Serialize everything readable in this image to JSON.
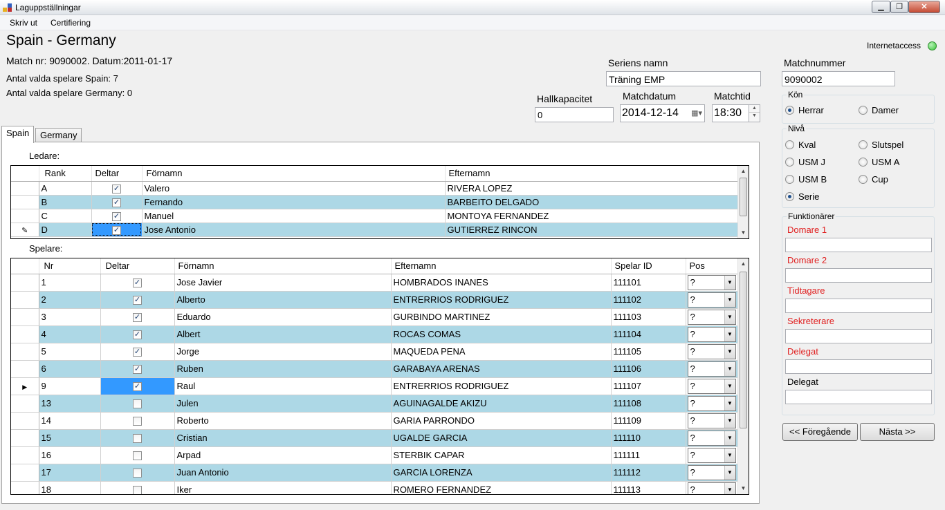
{
  "window": {
    "title": "Laguppställningar"
  },
  "menu": [
    {
      "label": "Skriv ut"
    },
    {
      "label": "Certifiering"
    }
  ],
  "header": {
    "title": "Spain - Germany",
    "match_info": "Match nr: 9090002.  Datum:2011-01-17",
    "selected_home": "Antal valda spelare Spain: 7",
    "selected_away": "Antal valda spelare Germany: 0",
    "internet_label": "Internetaccess",
    "internet_status_color": "#3cc83c"
  },
  "fields": {
    "series_label": "Seriens namn",
    "series_value": "Träning EMP",
    "matchnr_label": "Matchnummer",
    "matchnr_value": "9090002",
    "hall_label": "Hallkapacitet",
    "hall_value": "0",
    "date_label": "Matchdatum",
    "date_value": "2014-12-14",
    "time_label": "Matchtid",
    "time_value": "18:30",
    "calendar_icon": "calendar-icon"
  },
  "gender": {
    "title": "Kön",
    "options": [
      {
        "label": "Herrar",
        "selected": true
      },
      {
        "label": "Damer",
        "selected": false
      }
    ]
  },
  "level": {
    "title": "Nivå",
    "options": [
      {
        "label": "Kval",
        "selected": false
      },
      {
        "label": "Slutspel",
        "selected": false
      },
      {
        "label": "USM J",
        "selected": false
      },
      {
        "label": "USM A",
        "selected": false
      },
      {
        "label": "USM B",
        "selected": false
      },
      {
        "label": "Cup",
        "selected": false
      },
      {
        "label": "Serie",
        "selected": true
      }
    ]
  },
  "officials": {
    "title": "Funktionärer",
    "items": [
      {
        "label": "Domare 1",
        "value": ""
      },
      {
        "label": "Domare 2",
        "value": ""
      },
      {
        "label": "Tidtagare",
        "value": ""
      },
      {
        "label": "Sekreterare",
        "value": ""
      },
      {
        "label": "Delegat",
        "value": ""
      },
      {
        "label": "Delegat",
        "value": ""
      }
    ],
    "required_color": "#e02020"
  },
  "nav": {
    "prev_label": "<< Föregående",
    "next_label": "Nästa >>"
  },
  "tabs": [
    {
      "label": "Spain",
      "active": true
    },
    {
      "label": "Germany",
      "active": false
    }
  ],
  "leaders": {
    "label": "Ledare:",
    "columns": [
      "Rank",
      "Deltar",
      "Förnamn",
      "Efternamn"
    ],
    "rows": [
      {
        "rank": "A",
        "deltar": true,
        "first": "Valero",
        "last": "RIVERA LOPEZ"
      },
      {
        "rank": "B",
        "deltar": true,
        "first": "Fernando",
        "last": "BARBEITO DELGADO"
      },
      {
        "rank": "C",
        "deltar": true,
        "first": "Manuel",
        "last": "MONTOYA FERNANDEZ"
      },
      {
        "rank": "D",
        "deltar": true,
        "first": "Jose Antonio",
        "last": "GUTIERREZ RINCON"
      }
    ]
  },
  "players": {
    "label": "Spelare:",
    "columns": [
      "Nr",
      "Deltar",
      "Förnamn",
      "Efternamn",
      "Spelar ID",
      "Pos"
    ],
    "rows": [
      {
        "nr": "1",
        "deltar": true,
        "first": "Jose Javier",
        "last": "HOMBRADOS INANES",
        "id": "111101",
        "pos": "?"
      },
      {
        "nr": "2",
        "deltar": true,
        "first": "Alberto",
        "last": "ENTRERRIOS RODRIGUEZ",
        "id": "111102",
        "pos": "?"
      },
      {
        "nr": "3",
        "deltar": true,
        "first": "Eduardo",
        "last": "GURBINDO MARTINEZ",
        "id": "111103",
        "pos": "?"
      },
      {
        "nr": "4",
        "deltar": true,
        "first": "Albert",
        "last": "ROCAS COMAS",
        "id": "111104",
        "pos": "?"
      },
      {
        "nr": "5",
        "deltar": true,
        "first": "Jorge",
        "last": "MAQUEDA PENA",
        "id": "111105",
        "pos": "?"
      },
      {
        "nr": "6",
        "deltar": true,
        "first": "Ruben",
        "last": "GARABAYA ARENAS",
        "id": "111106",
        "pos": "?"
      },
      {
        "nr": "9",
        "deltar": true,
        "first": "Raul",
        "last": "ENTRERRIOS RODRIGUEZ",
        "id": "111107",
        "pos": "?"
      },
      {
        "nr": "13",
        "deltar": false,
        "first": "Julen",
        "last": "AGUINAGALDE AKIZU",
        "id": "111108",
        "pos": "?"
      },
      {
        "nr": "14",
        "deltar": false,
        "first": "Roberto",
        "last": "GARIA PARRONDO",
        "id": "111109",
        "pos": "?"
      },
      {
        "nr": "15",
        "deltar": false,
        "first": "Cristian",
        "last": "UGALDE GARCIA",
        "id": "111110",
        "pos": "?"
      },
      {
        "nr": "16",
        "deltar": false,
        "first": "Arpad",
        "last": "STERBIK CAPAR",
        "id": "111111",
        "pos": "?"
      },
      {
        "nr": "17",
        "deltar": false,
        "first": "Juan Antonio",
        "last": "GARCIA LORENZA",
        "id": "111112",
        "pos": "?"
      },
      {
        "nr": "18",
        "deltar": false,
        "first": "Iker",
        "last": "ROMERO FERNANDEZ",
        "id": "111113",
        "pos": "?"
      }
    ]
  }
}
